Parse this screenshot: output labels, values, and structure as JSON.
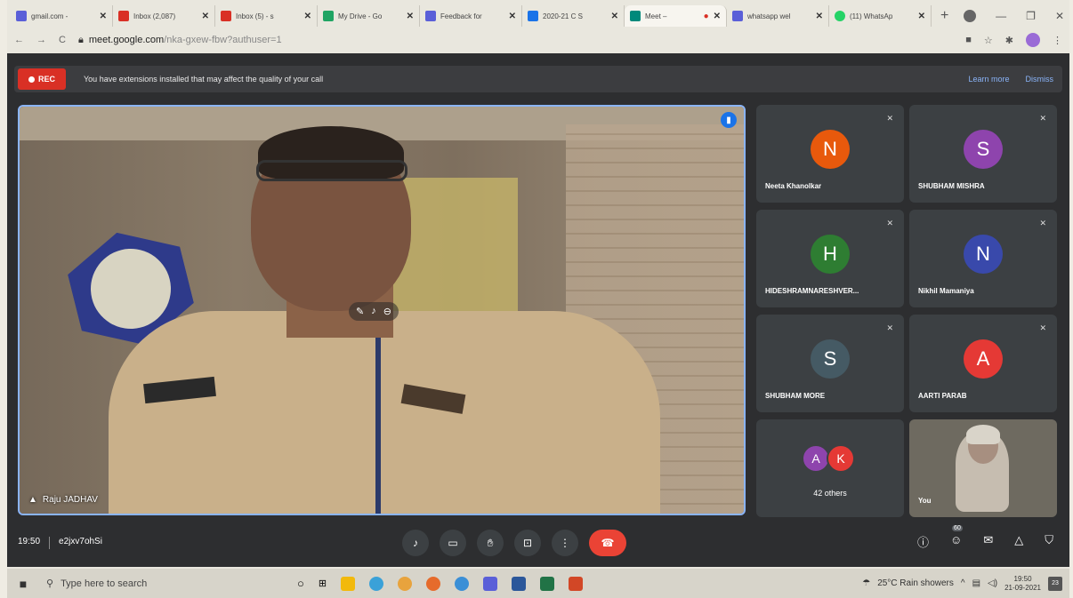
{
  "browser": {
    "tabs": [
      {
        "title": "gmail.com - ",
        "color": "#5a5fd8"
      },
      {
        "title": "Inbox (2,087)",
        "color": "#d93025"
      },
      {
        "title": "Inbox (5) - s",
        "color": "#d93025"
      },
      {
        "title": "My Drive - Go",
        "color": "#1fa463"
      },
      {
        "title": "Feedback for",
        "color": "#5a5fd8"
      },
      {
        "title": "2020-21 C S",
        "color": "#1a73e8"
      },
      {
        "title": "Meet – ",
        "color": "#00897b"
      },
      {
        "title": "whatsapp wel",
        "color": "#5a5fd8"
      },
      {
        "title": "(11) WhatsAp",
        "color": "#25d366"
      }
    ],
    "url_host": "meet.google.com",
    "url_path": "/nka-gxew-fbw?authuser=1"
  },
  "meet": {
    "rec_label": "REC",
    "banner_message": "You have extensions installed that may affect the quality of your call",
    "learn_more": "Learn more",
    "dismiss": "Dismiss",
    "main_speaker": "Raju JADHAV",
    "participants": [
      {
        "initial": "N",
        "name": "Neeta Khanolkar",
        "color": "#e8590c"
      },
      {
        "initial": "S",
        "name": "SHUBHAM MISHRA",
        "color": "#8e44ad"
      },
      {
        "initial": "H",
        "name": "HIDESHRAMNARESHVER...",
        "color": "#2e7d32"
      },
      {
        "initial": "N",
        "name": "Nikhil Mamaniya",
        "color": "#3949ab"
      },
      {
        "initial": "S",
        "name": "SHUBHAM MORE",
        "color": "#455a64"
      },
      {
        "initial": "A",
        "name": "AARTI PARAB",
        "color": "#e53935"
      }
    ],
    "others": {
      "avatars": [
        {
          "initial": "A",
          "color": "#8e44ad"
        },
        {
          "initial": "K",
          "color": "#e53935"
        }
      ],
      "label": "42 others"
    },
    "self_label": "You",
    "time": "19:50",
    "meeting_code": "e2jxv7ohSi",
    "people_count": "60"
  },
  "taskbar": {
    "search_placeholder": "Type here to search",
    "weather": "25°C  Rain showers",
    "clock_time": "19:50",
    "clock_date": "21-09-2021",
    "notifications": "23"
  }
}
